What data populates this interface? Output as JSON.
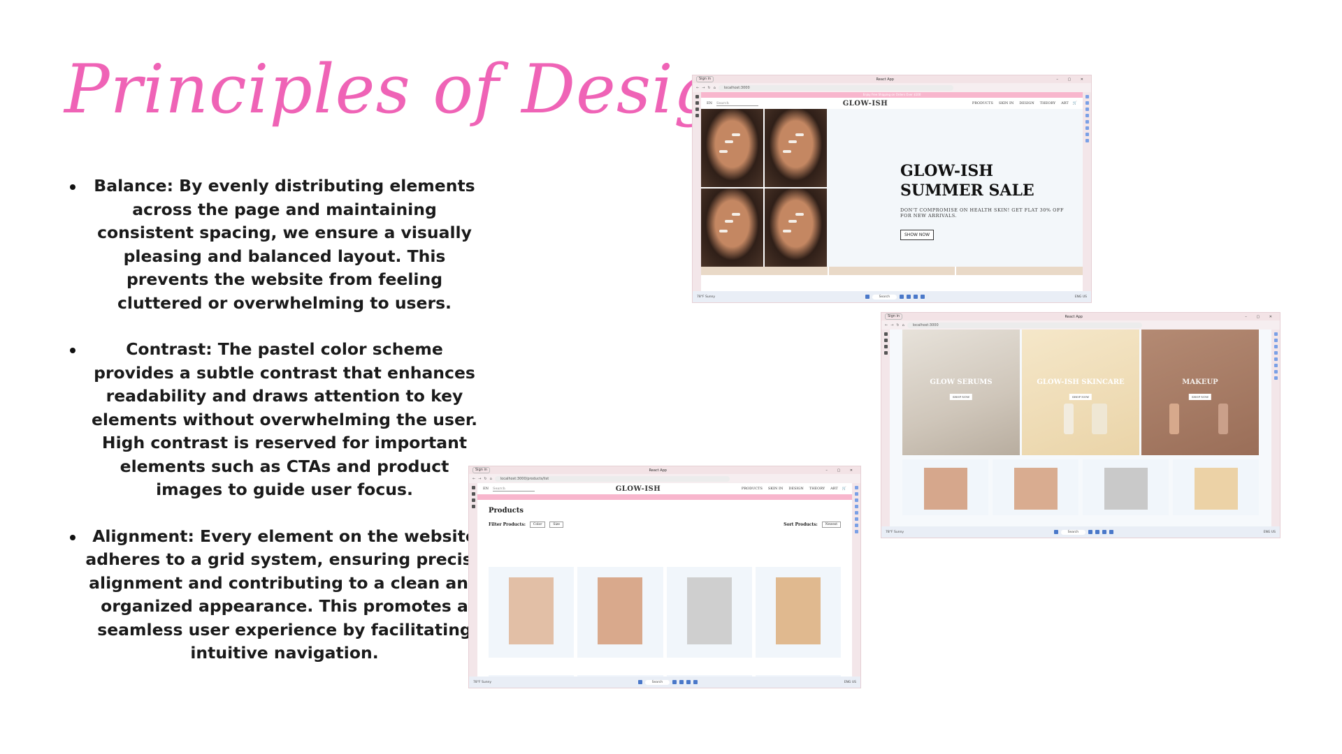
{
  "slide": {
    "title": "Principles of Design:",
    "bullets": [
      {
        "text": "Balance: By evenly distributing elements across the page and maintaining consistent spacing, we ensure a visually pleasing and balanced layout. This prevents the website from feeling cluttered or overwhelming to users."
      },
      {
        "text": "Contrast: The pastel color scheme provides a subtle contrast that enhances readability and draws attention to key elements without overwhelming the user. High contrast is reserved for important elements such as CTAs and product images to guide user focus."
      },
      {
        "text": "Alignment: Every element on the website adheres to a grid system, ensuring precise alignment and contributing to a clean and organized appearance. This promotes a seamless user experience by facilitating intuitive navigation."
      }
    ],
    "colors": {
      "title": "#ef63b6",
      "promo_bar": "#f8b6cd",
      "browser_frame": "#fbecee"
    }
  },
  "screenshot_home": {
    "tab_label": "Sign in",
    "window_title": "React App",
    "url": "localhost:3000",
    "promo_text": "Enjoy Free Shipping on Orders Over $100",
    "lang": "EN",
    "search_placeholder": "Search",
    "brand": "GLOW-ISH",
    "nav": [
      "PRODUCTS",
      "SKIN IN",
      "DESIGN",
      "THEORY",
      "ART"
    ],
    "hero_title_line1": "GLOW-ISH",
    "hero_title_line2": "SUMMER SALE",
    "hero_subtitle": "DON'T COMPROMISE ON HEALTH SKIN! GET FLAT 30% OFF FOR NEW ARRIVALS.",
    "hero_button": "SHOW NOW",
    "taskbar_weather": "78°F Sunny",
    "taskbar_search": "Search",
    "taskbar_lang": "ENG US"
  },
  "screenshot_categories": {
    "tab_label": "Sign in",
    "window_title": "React App",
    "url": "localhost:3000",
    "categories": [
      {
        "label": "GLOW SERUMS",
        "button": "SHOP NOW"
      },
      {
        "label": "GLOW-ISH SKINCARE",
        "button": "SHOP NOW"
      },
      {
        "label": "MAKEUP",
        "button": "SHOP NOW"
      }
    ],
    "taskbar_weather": "78°F Sunny",
    "taskbar_search": "Search",
    "taskbar_lang": "ENG US"
  },
  "screenshot_products": {
    "tab_label": "Sign in",
    "window_title": "React App",
    "url": "localhost:3000/products/list",
    "lang": "EN",
    "search_placeholder": "Search",
    "brand": "GLOW-ISH",
    "nav": [
      "PRODUCTS",
      "SKIN IN",
      "DESIGN",
      "THEORY",
      "ART"
    ],
    "heading": "Products",
    "filter_label": "Filter Products:",
    "filter_color": "Color",
    "filter_size": "Size",
    "sort_label": "Sort Products:",
    "sort_value": "Newest",
    "taskbar_weather": "78°F Sunny",
    "taskbar_search": "Search",
    "taskbar_lang": "ENG US"
  }
}
